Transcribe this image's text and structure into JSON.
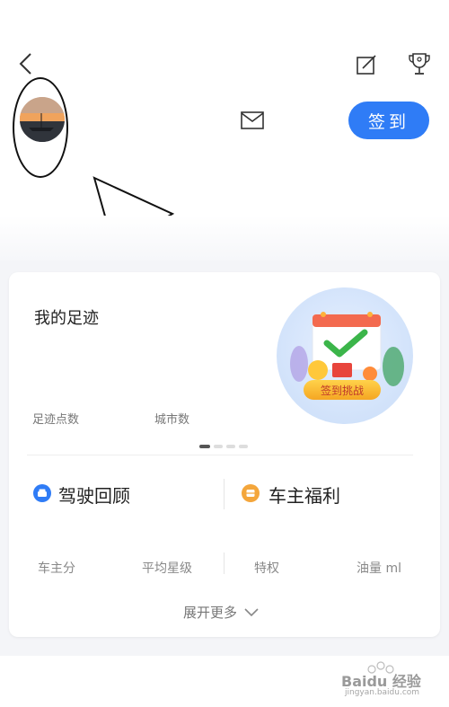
{
  "header": {
    "signin_label": "签到"
  },
  "footprint": {
    "title": "我的足迹",
    "stats": [
      {
        "label": "足迹点数"
      },
      {
        "label": "城市数"
      }
    ],
    "challenge_label": "签到挑战"
  },
  "sections": {
    "drive_review": "驾驶回顾",
    "owner_welfare": "车主福利"
  },
  "metrics": [
    {
      "label": "车主分"
    },
    {
      "label": "平均星级"
    },
    {
      "label": "特权"
    },
    {
      "label": "油量 ml"
    }
  ],
  "expand_label": "展开更多",
  "watermark": {
    "text": "Baidu 经验",
    "sub": "jingyan.baidu.com"
  },
  "colors": {
    "accent": "#2f7cf6",
    "welfare": "#f4a63b"
  }
}
